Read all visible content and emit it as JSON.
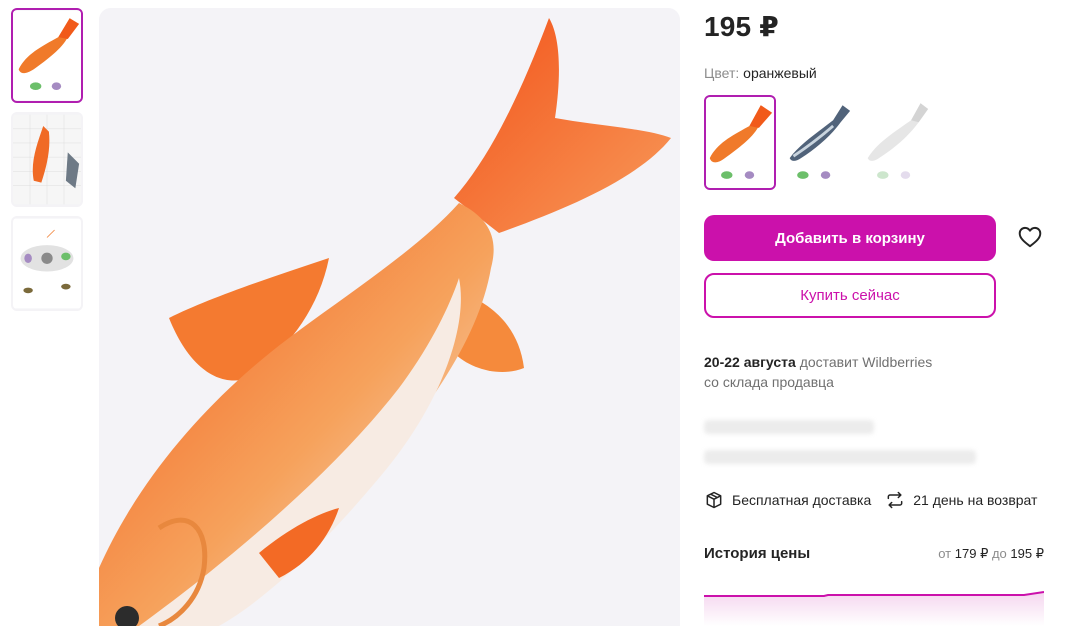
{
  "product": {
    "price": "195 ₽",
    "color_label": "Цвет:",
    "color_value": "оранжевый"
  },
  "thumbnails": [
    {
      "name": "orange-fish",
      "active": true
    },
    {
      "name": "orange-fish-size",
      "active": false
    },
    {
      "name": "fish-diagram",
      "active": false
    }
  ],
  "swatches": [
    {
      "name": "orange",
      "active": true
    },
    {
      "name": "mackerel",
      "active": false
    },
    {
      "name": "white",
      "active": false
    }
  ],
  "actions": {
    "add_to_cart": "Добавить в корзину",
    "buy_now": "Купить сейчас"
  },
  "delivery": {
    "dates": "20-22 августа",
    "by": "доставит Wildberries",
    "from": "со склада продавца"
  },
  "perks": {
    "free_delivery": "Бесплатная доставка",
    "returns": "21 день на возврат"
  },
  "price_history": {
    "title": "История цены",
    "from_word": "от",
    "min": "179 ₽",
    "to_word": "до",
    "max": "195 ₽"
  },
  "colors": {
    "accent": "#cb11ab",
    "text": "#242424",
    "muted": "#8c8c8c"
  }
}
